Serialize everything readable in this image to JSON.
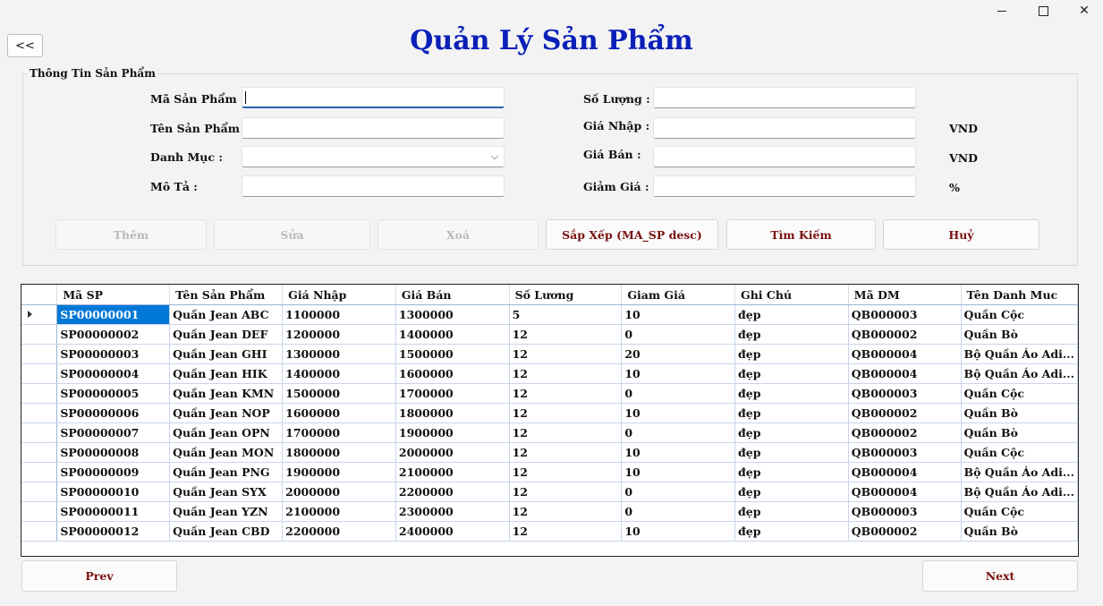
{
  "window": {
    "minimize_glyph": "─",
    "maximize_glyph": "☐",
    "close_glyph": "✕"
  },
  "back_label": "<<",
  "title": "Quản Lý Sản Phẩm",
  "form": {
    "legend": "Thông Tin Sản Phẩm",
    "ma_sp_label": "Mã Sản Phẩm :",
    "ma_sp_value": "",
    "ten_sp_label": "Tên Sản Phẩm :",
    "ten_sp_value": "",
    "danh_muc_label": "Danh Mục :",
    "danh_muc_value": "",
    "mo_ta_label": "Mô Tả :",
    "mo_ta_value": "",
    "so_luong_label": "Số Lượng :",
    "so_luong_value": "",
    "gia_nhap_label": "Giá Nhập :",
    "gia_nhap_value": "",
    "gia_ban_label": "Giá Bán :",
    "gia_ban_value": "",
    "giam_gia_label": "Giảm Giá :",
    "giam_gia_value": "",
    "unit_vnd_1": "VND",
    "unit_vnd_2": "VND",
    "unit_percent": "%"
  },
  "actions": {
    "them": "Thêm",
    "sua": "Sửa",
    "xoa": "Xoá",
    "sap_xep": "Sắp Xếp (MA_SP desc)",
    "tim_kiem": "Tìm Kiếm",
    "huy": "Huỷ"
  },
  "table": {
    "columns": [
      "Mã SP",
      "Tên Sản Phẩm",
      "Giá Nhập",
      "Giá Bán",
      "Số Lương",
      "Giam Giá",
      "Ghi Chú",
      "Mã DM",
      "Tên Danh Muc"
    ],
    "rows": [
      [
        "SP00000001",
        "Quần Jean ABC",
        "1100000",
        "1300000",
        "5",
        "10",
        "đẹp",
        "QB000003",
        "Quần Cộc"
      ],
      [
        "SP00000002",
        "Quần Jean DEF",
        "1200000",
        "1400000",
        "12",
        "0",
        "đẹp",
        "QB000002",
        "Quần Bò"
      ],
      [
        "SP00000003",
        "Quần Jean GHI",
        "1300000",
        "1500000",
        "12",
        "20",
        "đẹp",
        "QB000004",
        "Bộ Quần Áo Adi..."
      ],
      [
        "SP00000004",
        "Quần Jean HIK",
        "1400000",
        "1600000",
        "12",
        "10",
        "đẹp",
        "QB000004",
        "Bộ Quần Áo Adi..."
      ],
      [
        "SP00000005",
        "Quần Jean KMN",
        "1500000",
        "1700000",
        "12",
        "0",
        "đẹp",
        "QB000003",
        "Quần Cộc"
      ],
      [
        "SP00000006",
        "Quần Jean NOP",
        "1600000",
        "1800000",
        "12",
        "10",
        "đẹp",
        "QB000002",
        "Quần Bò"
      ],
      [
        "SP00000007",
        "Quần Jean OPN",
        "1700000",
        "1900000",
        "12",
        "0",
        "đẹp",
        "QB000002",
        "Quần Bò"
      ],
      [
        "SP00000008",
        "Quần Jean MON",
        "1800000",
        "2000000",
        "12",
        "10",
        "đẹp",
        "QB000003",
        "Quần Cộc"
      ],
      [
        "SP00000009",
        "Quần Jean PNG",
        "1900000",
        "2100000",
        "12",
        "10",
        "đẹp",
        "QB000004",
        "Bộ Quần Áo Adi..."
      ],
      [
        "SP00000010",
        "Quần Jean SYX",
        "2000000",
        "2200000",
        "12",
        "0",
        "đẹp",
        "QB000004",
        "Bộ Quần Áo Adi..."
      ],
      [
        "SP00000011",
        "Quần Jean YZN",
        "2100000",
        "2300000",
        "12",
        "0",
        "đẹp",
        "QB000003",
        "Quần Cộc"
      ],
      [
        "SP00000012",
        "Quần Jean CBD",
        "2200000",
        "2400000",
        "12",
        "10",
        "đẹp",
        "QB000002",
        "Quần Bò"
      ]
    ]
  },
  "pager": {
    "prev": "Prev",
    "next": "Next"
  },
  "colors": {
    "title": "#0a20b8",
    "button_text": "#7a1010",
    "selection": "#0078d7"
  }
}
